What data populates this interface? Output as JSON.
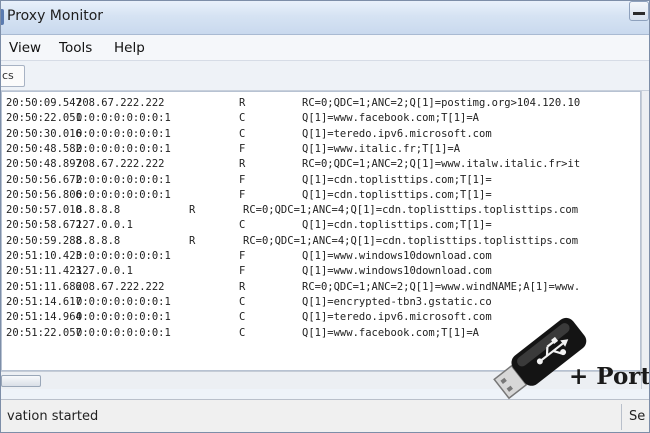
{
  "window": {
    "title": "Proxy Monitor",
    "minimize_label": ""
  },
  "menu": {
    "items": [
      "View",
      "Tools",
      "Help"
    ]
  },
  "toolbar": {
    "tab_label": "cs"
  },
  "log": {
    "rows": [
      {
        "time": "20:50:09.547",
        "ip": "208.67.222.222",
        "type": "R",
        "query": "RC=0;QDC=1;ANC=2;Q[1]=postimg.org>104.120.10",
        "shift": false
      },
      {
        "time": "20:50:22.051",
        "ip": "0:0:0:0:0:0:0:1",
        "type": "C",
        "query": "Q[1]=www.facebook.com;T[1]=A",
        "shift": false
      },
      {
        "time": "20:50:30.016",
        "ip": "0:0:0:0:0:0:0:1",
        "type": "C",
        "query": "Q[1]=teredo.ipv6.microsoft.com",
        "shift": false
      },
      {
        "time": "20:50:48.582",
        "ip": "0:0:0:0:0:0:0:1",
        "type": "F",
        "query": "Q[1]=www.italic.fr;T[1]=A",
        "shift": false
      },
      {
        "time": "20:50:48.897",
        "ip": "208.67.222.222",
        "type": "R",
        "query": "RC=0;QDC=1;ANC=2;Q[1]=www.italw.italic.fr>it",
        "shift": false
      },
      {
        "time": "20:50:56.672",
        "ip": "0:0:0:0:0:0:0:1",
        "type": "F",
        "query": "Q[1]=cdn.toplisttips.com;T[1]=",
        "shift": false
      },
      {
        "time": "20:50:56.806",
        "ip": "0:0:0:0:0:0:0:1",
        "type": "F",
        "query": "Q[1]=cdn.toplisttips.com;T[1]=",
        "shift": false
      },
      {
        "time": "20:50:57.010",
        "ip": "8.8.8.8",
        "type": "R",
        "query": "RC=0;QDC=1;ANC=4;Q[1]=cdn.toplisttips.toplisttips.com",
        "shift": true
      },
      {
        "time": "20:50:58.672",
        "ip": "127.0.0.1",
        "type": "C",
        "query": "Q[1]=cdn.toplisttips.com;T[1]=",
        "shift": false
      },
      {
        "time": "20:50:59.288",
        "ip": "8.8.8.8",
        "type": "R",
        "query": "RC=0;QDC=1;ANC=4;Q[1]=cdn.toplisttips.toplisttips.com",
        "shift": true
      },
      {
        "time": "20:51:10.423",
        "ip": "0:0:0:0:0:0:0:1",
        "type": "F",
        "query": "Q[1]=www.windows10download.com",
        "shift": false
      },
      {
        "time": "20:51:11.423",
        "ip": "127.0.0.1",
        "type": "F",
        "query": "Q[1]=www.windows10download.com",
        "shift": false
      },
      {
        "time": "20:51:11.686",
        "ip": "208.67.222.222",
        "type": "R",
        "query": "RC=0;QDC=1;ANC=2;Q[1]=www.windNAME;A[1]=www.",
        "shift": false
      },
      {
        "time": "20:51:14.617",
        "ip": "0:0:0:0:0:0:0:1",
        "type": "C",
        "query": "Q[1]=encrypted-tbn3.gstatic.co",
        "shift": false
      },
      {
        "time": "20:51:14.964",
        "ip": "0:0:0:0:0:0:0:1",
        "type": "C",
        "query": "Q[1]=teredo.ipv6.microsoft.com",
        "shift": false
      },
      {
        "time": "20:51:22.057",
        "ip": "0:0:0:0:0:0:0:1",
        "type": "C",
        "query": "Q[1]=www.facebook.com;T[1]=A",
        "shift": false
      }
    ]
  },
  "status": {
    "left": "vation started",
    "right": "Se"
  },
  "overlay": {
    "portable_label": "+ Port",
    "usb_icon": "usb-stick-icon"
  },
  "colors": {
    "title_bg": "#d6e3f3",
    "log_bg": "#ffffff",
    "status_bg": "#f0f0f0"
  }
}
